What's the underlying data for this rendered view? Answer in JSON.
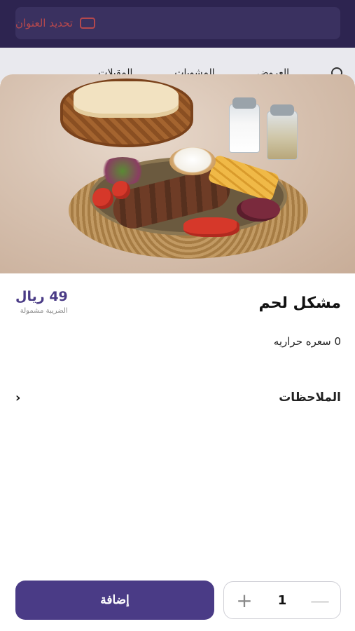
{
  "background": {
    "address_text": "تحديد العنوان",
    "tabs": [
      "العروض",
      "المشويات",
      "المقبلات"
    ]
  },
  "product": {
    "title": "مشكل لحم",
    "price": "49 ريال",
    "tax_note": "الضريبة مشمولة",
    "calories": "0 سعره حراريه",
    "image_icon": "food-photo"
  },
  "notes": {
    "label": "الملاحظات",
    "icon": "chevron-left-icon"
  },
  "actions": {
    "add_label": "إضافة",
    "quantity": "1",
    "plus_symbol": "+",
    "minus_symbol": "—"
  },
  "colors": {
    "primary": "#4a3b86",
    "header_bg": "#2d2450",
    "address_accent": "#b5484d"
  }
}
